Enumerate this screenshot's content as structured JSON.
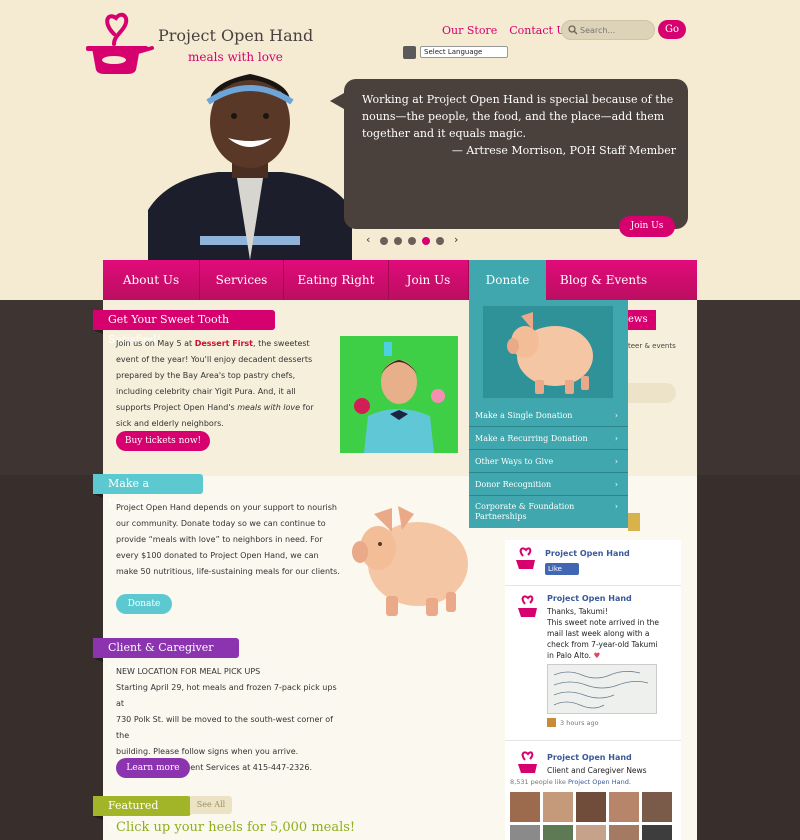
{
  "header": {
    "brand": "Project Open Hand",
    "tagline": "meals with love",
    "links": [
      "Our Store",
      "Contact Us"
    ],
    "search_placeholder": "Search...",
    "go_label": "Go",
    "language_select": "Select Language"
  },
  "hero": {
    "quote": "Working at Project Open Hand is special because of the nouns—the people, the food, and the place—add them together and it equals magic.",
    "author": "— Artrese Morrison, POH Staff Member",
    "cta": "Join Us",
    "slides_total": 5,
    "active_slide": 4
  },
  "nav": {
    "items": [
      "About Us",
      "Services",
      "Eating Right",
      "Join Us",
      "Donate",
      "Blog & Events"
    ],
    "active": "Donate"
  },
  "donate_menu": {
    "items": [
      "Make a Single Donation",
      "Make a Recurring Donation",
      "Other Ways to Give",
      "Donor Recognition",
      "Corporate & Foundation Partnerships"
    ]
  },
  "sweet_tooth": {
    "heading": "Get Your Sweet Tooth Satisfied!",
    "text_1": "Join us on May 5 at ",
    "highlight": "Dessert First",
    "text_2": ", the sweetest event of the year! You'll enjoy decadent desserts prepared by the Bay Area's top pastry chefs, including celebrity chair Yigit Pura.  And, it all supports Project Open Hand's ",
    "emph": "meals with love",
    "text_3": " for sick and elderly neighbors.",
    "button": "Buy tickets now!"
  },
  "donation": {
    "heading": "Make a Donation",
    "text": "Project Open Hand depends on your support to nourish our community. Donate today so we can continue to provide “meals with love” to neighbors in need. For every $100 donated to Project Open Hand, we can make 50 nutritious, life-sustaining meals for our clients.",
    "button": "Donate"
  },
  "client_news": {
    "heading": "Client & Caregiver News",
    "lines": [
      "NEW LOCATION FOR MEAL PICK UPS",
      "Starting April 29, hot meals and frozen 7-pack pick ups at",
      "730 Polk St. will be moved to the south-west corner of the",
      "building. Please follow signs when you arrive.",
      "Questions? Call Client Services at 415-447-2326."
    ],
    "button": "Learn more"
  },
  "featured": {
    "heading": "Featured News",
    "see_all": "See All",
    "headline": "Click up your heels for 5,000 meals!"
  },
  "right_column": {
    "ribbon_tail": "ews",
    "events_tail": "teer & events"
  },
  "facebook": {
    "page_name": "Project Open Hand",
    "like_label": "Like",
    "post_1": {
      "author": "Project Open Hand",
      "lines": [
        "Thanks, Takumi!",
        "This sweet note arrived in the",
        "mail last week along with a",
        "check from 7-year-old Takumi",
        "in Palo Alto."
      ],
      "time": "3 hours ago"
    },
    "post_2": {
      "author": "Project Open Hand",
      "line": "Client and Caregiver News"
    },
    "likes_count": "8,531",
    "likes_text": " people like ",
    "likes_page": "Project Open Hand."
  },
  "colors": {
    "brand_pink": "#d6006e",
    "teal": "#3fa7ad",
    "purple": "#8c34b0",
    "olive": "#a2b528",
    "cream": "#f4ebd2",
    "dark": "#3e3533"
  }
}
